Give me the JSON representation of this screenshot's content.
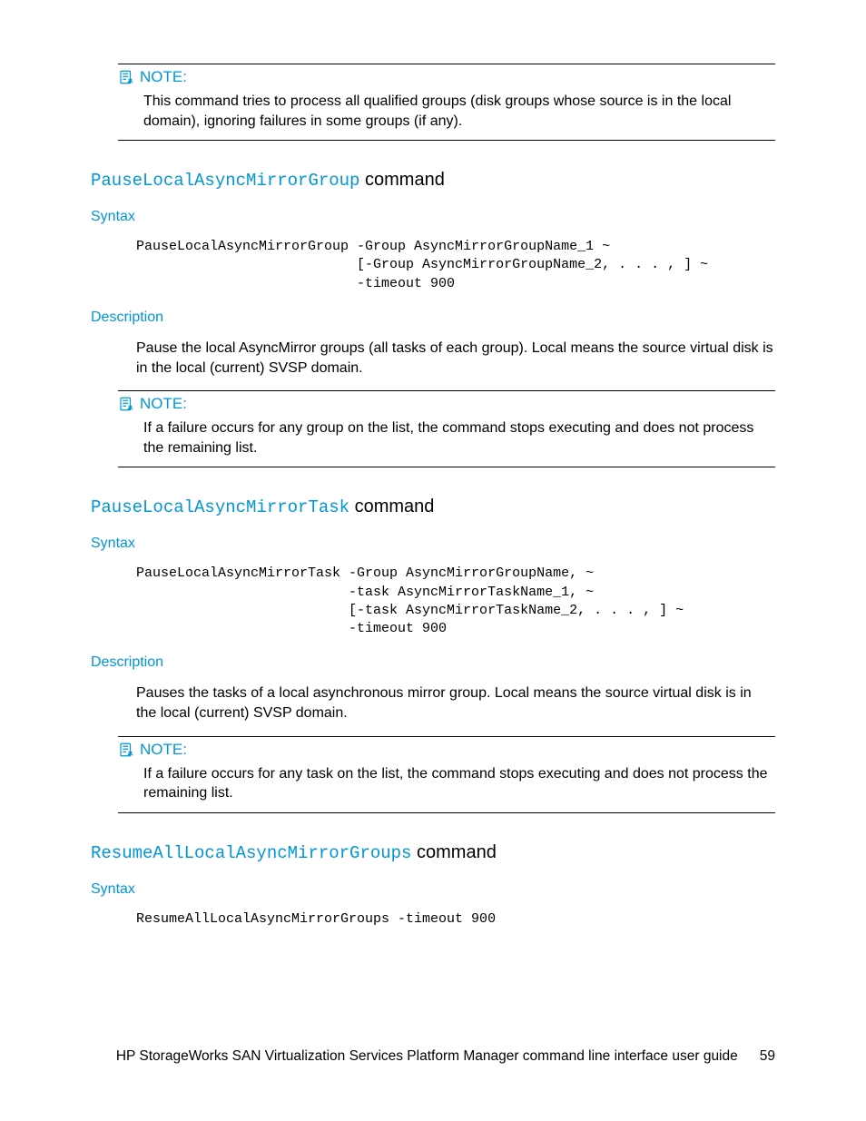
{
  "notes_label": "NOTE:",
  "note1": {
    "body": "This command tries to process all qualified groups (disk groups whose source is in the local domain), ignoring failures in some groups (if any)."
  },
  "section1": {
    "cmd": "PauseLocalAsyncMirrorGroup",
    "suffix": " command",
    "syntax_label": "Syntax",
    "syntax_code": "PauseLocalAsyncMirrorGroup -Group AsyncMirrorGroupName_1 ~\n                           [-Group AsyncMirrorGroupName_2, . . . , ] ~\n                           -timeout 900",
    "desc_label": "Description",
    "desc_body": "Pause the local AsyncMirror groups (all tasks of each group). Local means the source virtual disk is in the local (current) SVSP domain.",
    "note_body": "If a failure occurs for any group on the list, the command stops executing and does not process the remaining list."
  },
  "section2": {
    "cmd": "PauseLocalAsyncMirrorTask",
    "suffix": " command",
    "syntax_label": "Syntax",
    "syntax_code": "PauseLocalAsyncMirrorTask -Group AsyncMirrorGroupName, ~\n                          -task AsyncMirrorTaskName_1, ~\n                          [-task AsyncMirrorTaskName_2, . . . , ] ~\n                          -timeout 900",
    "desc_label": "Description",
    "desc_body": "Pauses the tasks of a local asynchronous mirror group. Local means the source virtual disk is in the local (current) SVSP domain.",
    "note_body": "If a failure occurs for any task on the list, the command stops executing and does not process the remaining list."
  },
  "section3": {
    "cmd": "ResumeAllLocalAsyncMirrorGroups",
    "suffix": " command",
    "syntax_label": "Syntax",
    "syntax_code": "ResumeAllLocalAsyncMirrorGroups -timeout 900"
  },
  "footer": {
    "title": "HP StorageWorks SAN Virtualization Services Platform Manager command line interface user guide",
    "page": "59"
  }
}
